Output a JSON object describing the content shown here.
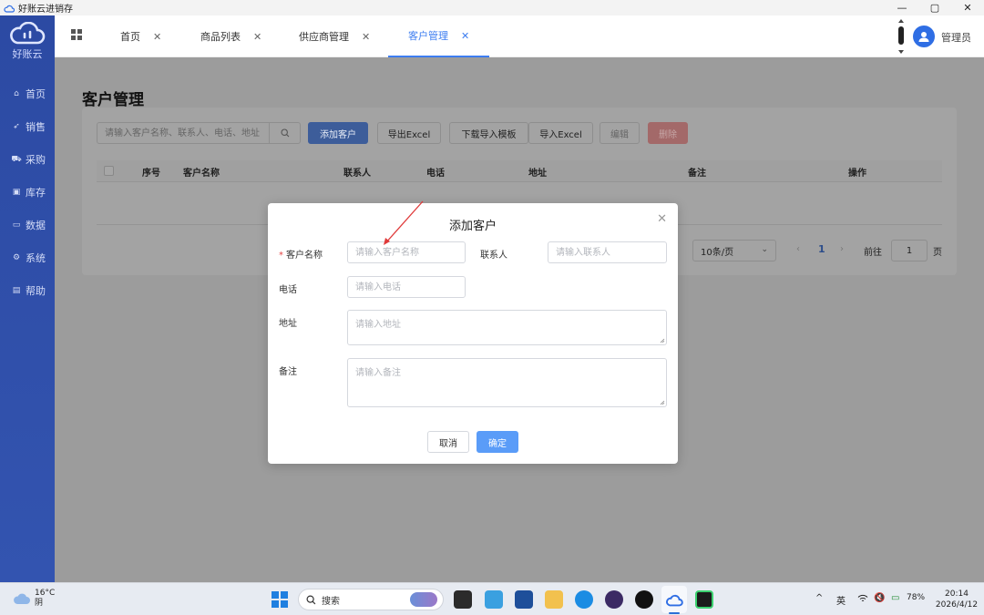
{
  "window": {
    "title": "好账云进销存",
    "controls": [
      "—",
      "▢",
      "✕"
    ]
  },
  "sidebar": {
    "brand": "好账云",
    "items": [
      {
        "label": "首页",
        "icon": "home-icon"
      },
      {
        "label": "销售",
        "icon": "send-icon"
      },
      {
        "label": "采购",
        "icon": "cart-icon"
      },
      {
        "label": "库存",
        "icon": "warehouse-icon"
      },
      {
        "label": "数据",
        "icon": "monitor-icon"
      },
      {
        "label": "系统",
        "icon": "gear-icon"
      },
      {
        "label": "帮助",
        "icon": "help-icon"
      }
    ]
  },
  "tabs": [
    {
      "label": "首页",
      "active": false
    },
    {
      "label": "商品列表",
      "active": false
    },
    {
      "label": "供应商管理",
      "active": false
    },
    {
      "label": "客户管理",
      "active": true
    }
  ],
  "user": {
    "name": "管理员"
  },
  "page": {
    "title": "客户管理",
    "search_placeholder": "请输入客户名称、联系人、电话、地址",
    "buttons": {
      "add": "添加客户",
      "export": "导出Excel",
      "template": "下载导入模板",
      "import": "导入Excel",
      "edit": "编辑",
      "delete": "删除"
    },
    "columns": [
      "序号",
      "客户名称",
      "联系人",
      "电话",
      "地址",
      "备注",
      "操作"
    ],
    "pager": {
      "page_size": "10条/页",
      "current": "1",
      "goto_label": "前往",
      "goto_value": "1",
      "unit": "页"
    }
  },
  "modal": {
    "title": "添加客户",
    "fields": {
      "name": {
        "label": "客户名称",
        "placeholder": "请输入客户名称",
        "required": true
      },
      "contact": {
        "label": "联系人",
        "placeholder": "请输入联系人"
      },
      "phone": {
        "label": "电话",
        "placeholder": "请输入电话"
      },
      "address": {
        "label": "地址",
        "placeholder": "请输入地址"
      },
      "remark": {
        "label": "备注",
        "placeholder": "请输入备注"
      }
    },
    "cancel": "取消",
    "confirm": "确定",
    "required_mark": "*"
  },
  "taskbar": {
    "weather": {
      "temp": "16°C",
      "desc": "阴"
    },
    "search_label": "搜索",
    "ime": "英",
    "battery": "78%",
    "time": "20:14",
    "date": "2026/4/12"
  },
  "colors": {
    "sidebar": "#2c4aa3",
    "accent": "#3d7df0",
    "confirm": "#5a9cf8",
    "required": "#e54545"
  }
}
